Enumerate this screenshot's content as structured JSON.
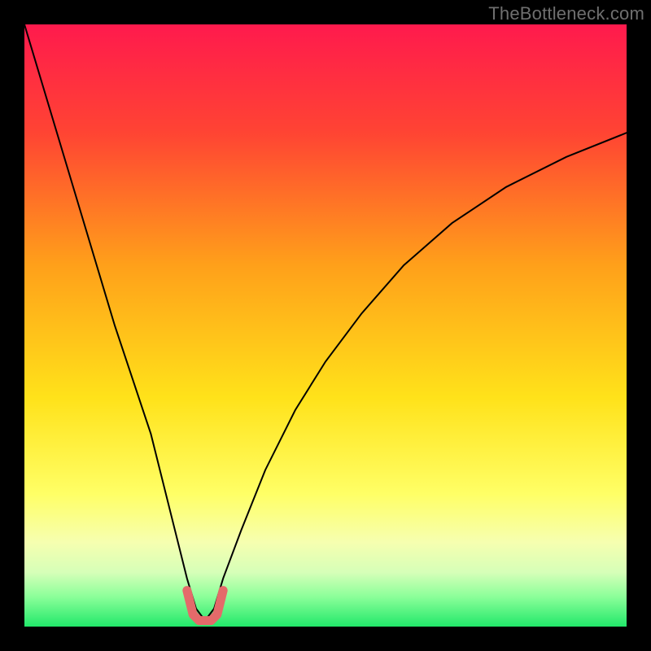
{
  "watermark": {
    "text": "TheBottleneck.com"
  },
  "chart_data": {
    "type": "line",
    "title": "",
    "xlabel": "",
    "ylabel": "",
    "xlim": [
      0,
      100
    ],
    "ylim": [
      0,
      100
    ],
    "grid": false,
    "legend": false,
    "background_gradient_stops": [
      {
        "offset": 0.0,
        "color": "#ff1a4d"
      },
      {
        "offset": 0.18,
        "color": "#ff4433"
      },
      {
        "offset": 0.4,
        "color": "#ffa01a"
      },
      {
        "offset": 0.62,
        "color": "#ffe21a"
      },
      {
        "offset": 0.78,
        "color": "#ffff66"
      },
      {
        "offset": 0.86,
        "color": "#f6ffb0"
      },
      {
        "offset": 0.91,
        "color": "#d6ffb8"
      },
      {
        "offset": 0.95,
        "color": "#8cff9a"
      },
      {
        "offset": 1.0,
        "color": "#22e86a"
      }
    ],
    "series": [
      {
        "name": "bottleneck-curve",
        "stroke": "#000000",
        "stroke_width": 2,
        "x": [
          0,
          3,
          6,
          9,
          12,
          15,
          18,
          21,
          23,
          25,
          27,
          28.5,
          30,
          31.5,
          33,
          36,
          40,
          45,
          50,
          56,
          63,
          71,
          80,
          90,
          100
        ],
        "values": [
          100,
          90,
          80,
          70,
          60,
          50,
          41,
          32,
          24,
          16,
          8,
          3,
          1,
          3,
          8,
          16,
          26,
          36,
          44,
          52,
          60,
          67,
          73,
          78,
          82
        ]
      },
      {
        "name": "notch-highlight",
        "stroke": "#e46a6a",
        "stroke_width": 11,
        "x": [
          27,
          28,
          29,
          30,
          31,
          32,
          33
        ],
        "values": [
          6,
          2,
          1,
          1,
          1,
          2,
          6
        ]
      }
    ]
  }
}
